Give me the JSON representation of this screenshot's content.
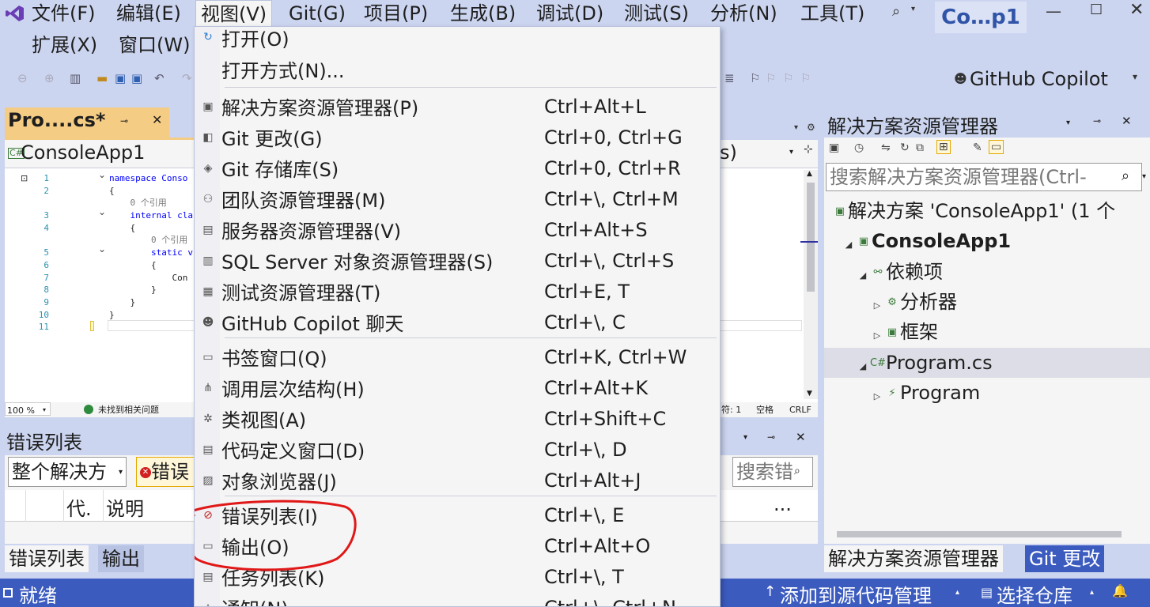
{
  "menubar": {
    "items": [
      "文件(F)",
      "编辑(E)",
      "视图(V)",
      "Git(G)",
      "项目(P)",
      "生成(B)",
      "调试(D)",
      "测试(S)",
      "分析(N)",
      "工具(T)"
    ],
    "row2": [
      "扩展(X)",
      "窗口(W)"
    ],
    "search_icon": "⌕",
    "solution_short": "Co…p1"
  },
  "toolbar": {
    "copilot_label": "GitHub Copilot"
  },
  "editor": {
    "tab_label": "Pro....cs*",
    "nav_project": "ConsoleApp1",
    "nav_member_suffix": "s)",
    "code_lines": [
      {
        "num": "1",
        "text": "namespace Conso"
      },
      {
        "num": "2",
        "text": "{"
      },
      {
        "num": "",
        "text": "    0 个引用"
      },
      {
        "num": "3",
        "text": "    internal cla"
      },
      {
        "num": "4",
        "text": "    {"
      },
      {
        "num": "",
        "text": "        0 个引用"
      },
      {
        "num": "5",
        "text": "        static v"
      },
      {
        "num": "6",
        "text": "        {"
      },
      {
        "num": "7",
        "text": "            Con"
      },
      {
        "num": "8",
        "text": "        }"
      },
      {
        "num": "9",
        "text": "    }"
      },
      {
        "num": "10",
        "text": "}"
      },
      {
        "num": "11",
        "text": ""
      }
    ],
    "zoom": "100 %",
    "status_ok": "未找到相关问题",
    "char_label": "符: 1",
    "space_label": "空格",
    "eol_label": "CRLF"
  },
  "view_menu": {
    "top_partial": "打开(O)",
    "items": [
      {
        "label": "打开方式(N)...",
        "shortcut": "",
        "icon": ""
      },
      {
        "label": "解决方案资源管理器(P)",
        "shortcut": "Ctrl+Alt+L",
        "icon": "▣"
      },
      {
        "label": "Git 更改(G)",
        "shortcut": "Ctrl+0, Ctrl+G",
        "icon": "◧"
      },
      {
        "label": "Git 存储库(S)",
        "shortcut": "Ctrl+0, Ctrl+R",
        "icon": "◈"
      },
      {
        "label": "团队资源管理器(M)",
        "shortcut": "Ctrl+\\, Ctrl+M",
        "icon": "⚇"
      },
      {
        "label": "服务器资源管理器(V)",
        "shortcut": "Ctrl+Alt+S",
        "icon": "▤"
      },
      {
        "label": "SQL Server 对象资源管理器(S)",
        "shortcut": "Ctrl+\\, Ctrl+S",
        "icon": "▥"
      },
      {
        "label": "测试资源管理器(T)",
        "shortcut": "Ctrl+E, T",
        "icon": "▦"
      },
      {
        "label": "GitHub Copilot 聊天",
        "shortcut": "Ctrl+\\, C",
        "icon": "☻"
      },
      {
        "label": "书签窗口(Q)",
        "shortcut": "Ctrl+K, Ctrl+W",
        "icon": "▭"
      },
      {
        "label": "调用层次结构(H)",
        "shortcut": "Ctrl+Alt+K",
        "icon": "⋔"
      },
      {
        "label": "类视图(A)",
        "shortcut": "Ctrl+Shift+C",
        "icon": "✲"
      },
      {
        "label": "代码定义窗口(D)",
        "shortcut": "Ctrl+\\, D",
        "icon": "▤"
      },
      {
        "label": "对象浏览器(J)",
        "shortcut": "Ctrl+Alt+J",
        "icon": "▨"
      },
      {
        "label": "错误列表(I)",
        "shortcut": "Ctrl+\\, E",
        "icon": "⊘"
      },
      {
        "label": "输出(O)",
        "shortcut": "Ctrl+Alt+O",
        "icon": "▭"
      },
      {
        "label": "任务列表(K)",
        "shortcut": "Ctrl+\\, T",
        "icon": "▤"
      },
      {
        "label": "通知(N)",
        "shortcut": "Ctrl+\\, Ctrl+N",
        "icon": "△"
      }
    ]
  },
  "error_list": {
    "title": "错误列表",
    "scope": "整个解决方",
    "errors_btn": "错误",
    "search_placeholder": "搜索错",
    "col_code": "代.",
    "col_desc": "说明",
    "more": "..."
  },
  "bottom_tabs": [
    "错误列表",
    "输出"
  ],
  "solution_explorer": {
    "title": "解决方案资源管理器",
    "search_placeholder": "搜索解决方案资源管理器(Ctrl-",
    "tree": [
      {
        "label": "解决方案 'ConsoleApp1' (1 个",
        "level": 0,
        "tri": "",
        "icon": "▣",
        "bold": false
      },
      {
        "label": "ConsoleApp1",
        "level": 1,
        "tri": "◢",
        "icon": "▣",
        "bold": true
      },
      {
        "label": "依赖项",
        "level": 2,
        "tri": "◢",
        "icon": "⚯",
        "bold": false
      },
      {
        "label": "分析器",
        "level": 3,
        "tri": "▷",
        "icon": "⚙",
        "bold": false
      },
      {
        "label": "框架",
        "level": 3,
        "tri": "▷",
        "icon": "▣",
        "bold": false
      },
      {
        "label": "Program.cs",
        "level": 2,
        "tri": "◢",
        "icon": "C#",
        "bold": false
      },
      {
        "label": "Program",
        "level": 3,
        "tri": "▷",
        "icon": "⚡",
        "bold": false
      }
    ],
    "tabs": [
      "解决方案资源管理器",
      "Git 更改"
    ]
  },
  "status_bar": {
    "ready": "就绪",
    "add_source": "添加到源代码管理",
    "select_repo": "选择仓库",
    "bell": "🔔"
  },
  "colors": {
    "accent_blue": "#007acc",
    "frame": "#ccd5f0",
    "status": "#3c5bbf",
    "tab_active": "#f5cc84",
    "annotation": "#e01818"
  }
}
